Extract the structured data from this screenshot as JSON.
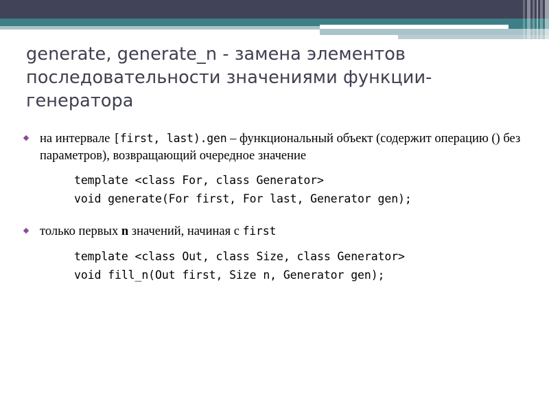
{
  "slide": {
    "title": "generate, generate_n - замена элементов последовательности значениями функции-генератора",
    "bullets": [
      {
        "marker": "diamond-bullet",
        "text_parts": {
          "p1": "на интервале ",
          "code1": "[first, last).gen",
          "p2": " – функциональный объект (содержит операцию () без параметров), возвращающий очередное значение"
        },
        "code_lines": [
          "template <class For, class Generator>",
          "void generate(For first, For last, Generator gen);"
        ]
      },
      {
        "marker": "diamond-bullet",
        "text_parts": {
          "p1": "только первых ",
          "bold": "n",
          "p2": " значений, начиная с ",
          "code1": "first"
        },
        "code_lines": [
          "template <class Out, class Size, class Generator>",
          "void fill_n(Out first, Size n, Generator gen);"
        ]
      }
    ]
  },
  "theme": {
    "title_color": "#3f404f",
    "band_dark": "#414458",
    "band_teal": "#3d7f86",
    "band_light_teal": "#a9c4c9",
    "bullet_color": "#8b4a97",
    "body_color": "#000000",
    "background": "#ffffff"
  }
}
